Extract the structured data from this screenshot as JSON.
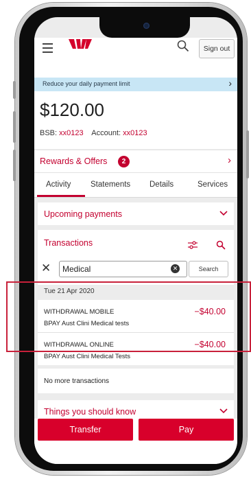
{
  "header": {
    "signout_label": "Sign out",
    "notice_text": "Reduce your daily payment limit"
  },
  "account": {
    "balance": "$120.00",
    "bsb_label": "BSB:",
    "bsb_value": "xx0123",
    "account_label": "Account:",
    "account_value": "xx0123"
  },
  "rewards": {
    "label": "Rewards & Offers",
    "badge_count": "2"
  },
  "tabs": [
    {
      "label": "Activity"
    },
    {
      "label": "Statements"
    },
    {
      "label": "Details"
    },
    {
      "label": "Services"
    }
  ],
  "upcoming": {
    "title": "Upcoming payments"
  },
  "transactions": {
    "title": "Transactions",
    "search_value": "Medical",
    "search_button": "Search",
    "date": "Tue 21 Apr 2020",
    "items": [
      {
        "line1": "WITHDRAWAL MOBILE",
        "line2": "BPAY Aust Clini Medical tests",
        "amount": "−$40.00"
      },
      {
        "line1": "WITHDRAWAL ONLINE",
        "line2": "BPAY Aust Clini Medical Tests",
        "amount": "−$40.00"
      }
    ],
    "no_more": "No more transactions"
  },
  "things": {
    "title": "Things you should know"
  },
  "footer": {
    "transfer_label": "Transfer",
    "pay_label": "Pay"
  },
  "colors": {
    "accent": "#c3002f",
    "button": "#d8002b",
    "notice_bg": "#c8e6f5"
  }
}
